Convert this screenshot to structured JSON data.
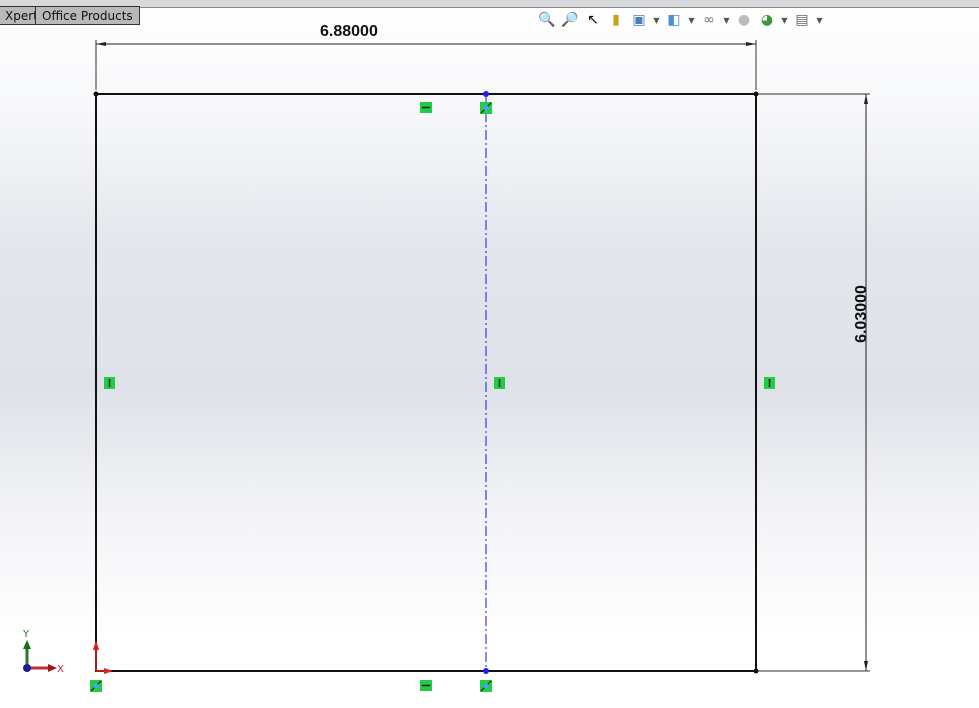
{
  "tabs": [
    {
      "label": "Xpert"
    },
    {
      "label": "Office Products"
    }
  ],
  "toolbar": {
    "icons": [
      "zoom-to-fit-icon",
      "zoom-to-area-icon",
      "previous-view-icon",
      "section-view-icon",
      "view-orientation-icon",
      "display-style-icon",
      "hide-show-items-icon",
      "edit-appearance-icon",
      "apply-scene-icon",
      "view-settings-icon"
    ]
  },
  "sketch": {
    "width_dimension": "6.88000",
    "height_dimension": "6.03000",
    "line_color": "#111111",
    "centerline_color": "#3a3af0",
    "relation_color": "#22cc44"
  },
  "triad": {
    "x_label": "X",
    "y_label": "Y"
  }
}
